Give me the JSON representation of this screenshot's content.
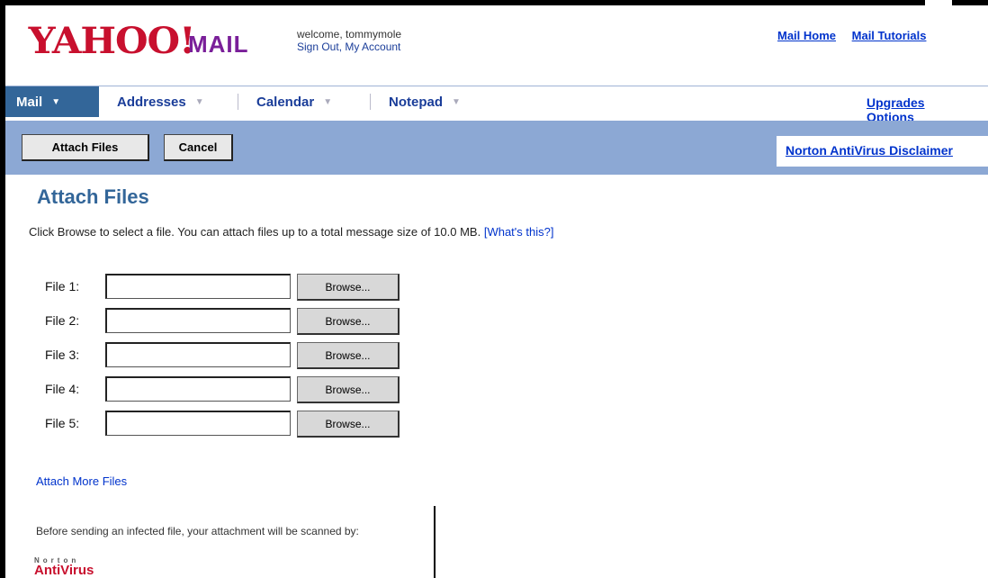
{
  "header": {
    "logo_text": "YAHOO!",
    "logo_mail": "MAIL",
    "welcome_line": "welcome, tommymole",
    "welcome_sub": "Sign Out, My Account",
    "links": [
      "Mail Home",
      "Mail Tutorials"
    ]
  },
  "tabs": [
    {
      "label": "Mail"
    },
    {
      "label": "Addresses"
    },
    {
      "label": "Calendar"
    },
    {
      "label": "Notepad"
    }
  ],
  "tab_links": [
    "Upgrades",
    "Options"
  ],
  "toolbar": {
    "attach_label": "Attach Files",
    "cancel_label": "Cancel",
    "norton_link": "Norton AntiVirus Disclaimer"
  },
  "main": {
    "title": "Attach Files",
    "description": "Click Browse to select a file. You can attach files up to a total message size of 10.0 MB. ",
    "whats_this": "[What's this?]",
    "files": [
      {
        "label": "File 1:",
        "value": "",
        "browse": "Browse..."
      },
      {
        "label": "File 2:",
        "value": "",
        "browse": "Browse..."
      },
      {
        "label": "File 3:",
        "value": "",
        "browse": "Browse..."
      },
      {
        "label": "File 4:",
        "value": "",
        "browse": "Browse..."
      },
      {
        "label": "File 5:",
        "value": "",
        "browse": "Browse..."
      }
    ],
    "attach_more": "Attach More Files",
    "av_text": "Before sending an infected file, your attachment will be scanned by:",
    "av_brand_small": "Norton",
    "av_brand_big": "AntiVirus"
  },
  "colors": {
    "brand_red": "#c8102e",
    "tab_active": "#336699",
    "toolbar_bg": "#8ca8d4",
    "link_blue": "#0033cc"
  }
}
